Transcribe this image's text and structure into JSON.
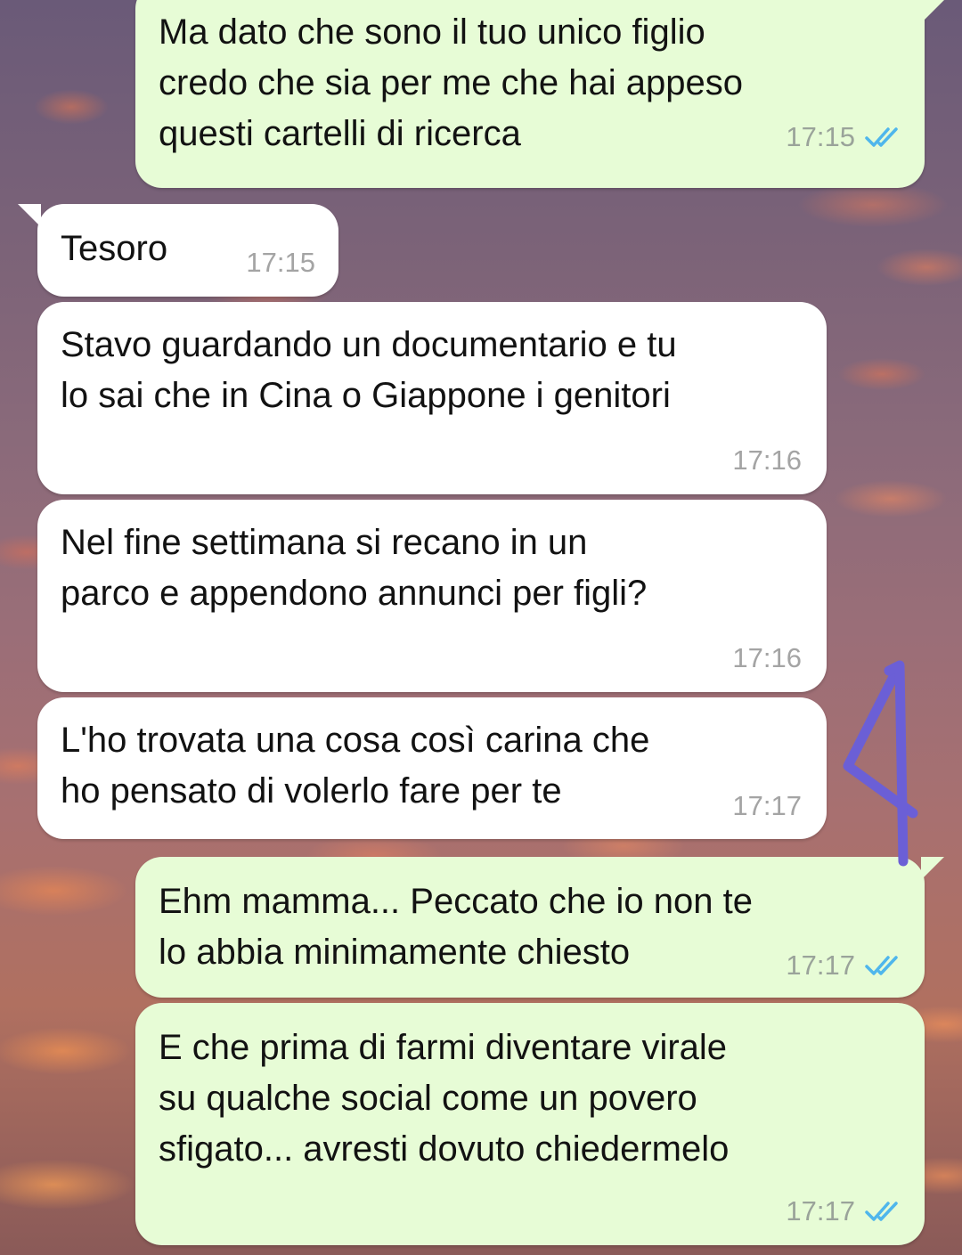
{
  "messages": [
    {
      "id": "m1",
      "direction": "out",
      "text": "Ma dato che sono il tuo unico figlio\ncredo che sia per me che hai appeso\nquesti cartelli di ricerca",
      "time": "17:15",
      "status": "read"
    },
    {
      "id": "m2",
      "direction": "in",
      "text": "Tesoro",
      "time": "17:15"
    },
    {
      "id": "m3",
      "direction": "in",
      "text": "Stavo guardando un documentario e tu\nlo sai che in Cina o Giappone i genitori",
      "time": "17:16"
    },
    {
      "id": "m4",
      "direction": "in",
      "text": "Nel fine settimana si recano in un\nparco e appendono annunci per figli?",
      "time": "17:16"
    },
    {
      "id": "m5",
      "direction": "in",
      "text": "L'ho trovata una cosa così carina che\nho pensato di volerlo fare per te",
      "time": "17:17"
    },
    {
      "id": "m6",
      "direction": "out",
      "text": "Ehm mamma... Peccato che io non te\nlo abbia minimamente chiesto",
      "time": "17:17",
      "status": "read"
    },
    {
      "id": "m7",
      "direction": "out",
      "text": "E che prima di farmi diventare virale\nsu qualche social come un povero\nsfigato... avresti dovuto chiedermelo",
      "time": "17:17",
      "status": "read"
    }
  ],
  "colors": {
    "outgoing_bubble": "#e7fcd6",
    "incoming_bubble": "#ffffff",
    "read_ticks": "#4fb6ec",
    "scribble": "#6b5fd6"
  },
  "icons": {
    "read_receipt": "double-check-icon",
    "annotation": "hand-drawn-number-4-scribble"
  }
}
